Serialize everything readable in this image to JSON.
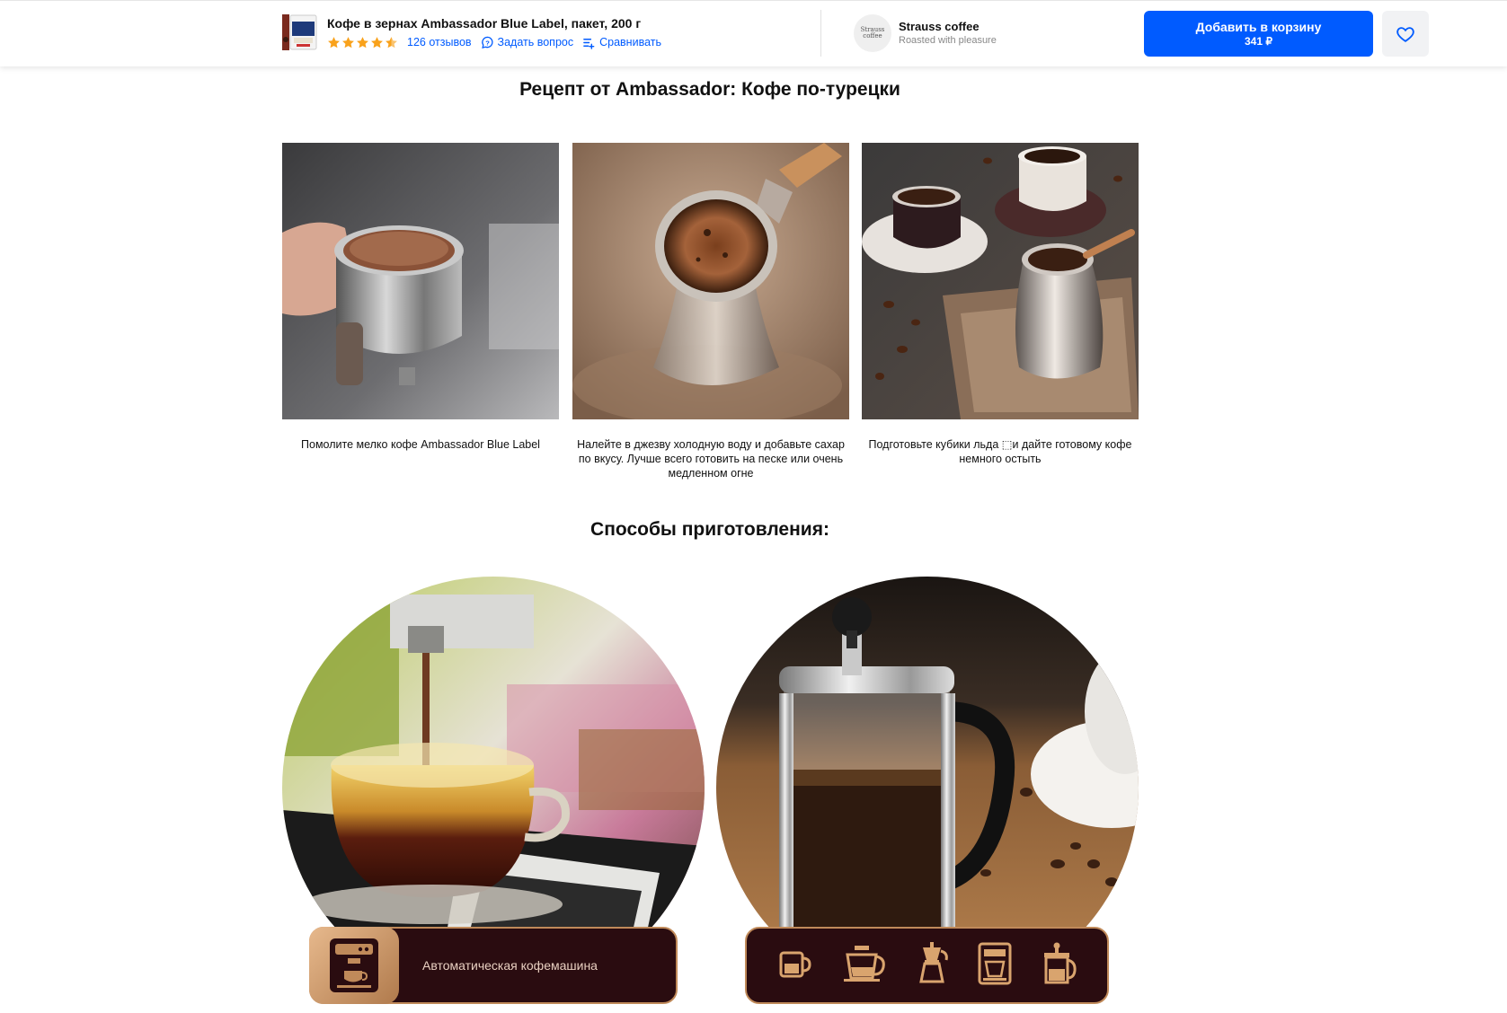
{
  "header": {
    "product_title": "Кофе в зернах Ambassador Blue Label, пакет, 200 г",
    "rating": 4.5,
    "reviews_link": "126 отзывов",
    "ask_link": "Задать вопрос",
    "compare_link": "Сравнивать",
    "seller_name": "Strauss coffee",
    "seller_tagline": "Roasted with pleasure",
    "seller_logo_text": "Strauss coffee",
    "cart_button_label": "Добавить в корзину",
    "cart_button_price": "341 ₽",
    "accent_color": "#005bff",
    "star_color": "#f9a21b"
  },
  "recipe": {
    "title": "Рецепт от Ambassador: Кофе по-турецки",
    "steps": [
      {
        "caption": "Помолите мелко кофе Ambassador Blue Label",
        "image": "ground-coffee-in-portafilter"
      },
      {
        "caption": "Налейте в джезву холодную воду и добавьте сахар по вкусу. Лучше всего готовить на песке или очень медленном огне",
        "image": "cezve-in-sand"
      },
      {
        "caption": "Подготовьте кубики льда ⬚и дайте готовому кофе немного остыть",
        "image": "coffee-cups-and-cezve"
      }
    ]
  },
  "methods": {
    "title": "Способы приготовления:",
    "items": [
      {
        "label": "Автоматическая кофемашина",
        "icon": "coffee-machine-icon",
        "image": "espresso-cup"
      },
      {
        "label": "",
        "icons": [
          "cup-icon",
          "pour-over-icon",
          "moka-pot-icon",
          "drip-machine-icon",
          "french-press-icon"
        ],
        "image": "french-press"
      }
    ],
    "badge_bg": "#2a0c10",
    "badge_gold": "#c08a5a"
  }
}
